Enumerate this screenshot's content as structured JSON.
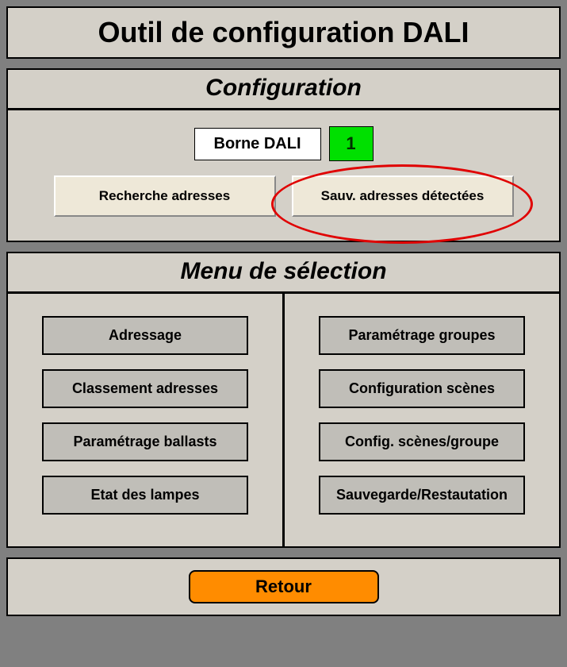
{
  "title": "Outil de configuration DALI",
  "config": {
    "heading": "Configuration",
    "borne_label": "Borne DALI",
    "borne_value": "1",
    "search_button": "Recherche adresses",
    "save_button": "Sauv. adresses détectées"
  },
  "selection": {
    "heading": "Menu de sélection",
    "left": [
      "Adressage",
      "Classement adresses",
      "Paramétrage ballasts",
      "Etat des lampes"
    ],
    "right": [
      "Paramétrage groupes",
      "Configuration scènes",
      "Config. scènes/groupe",
      "Sauvegarde/Restautation"
    ]
  },
  "footer": {
    "back_button": "Retour"
  },
  "colors": {
    "accent_green": "#00e000",
    "accent_orange": "#ff8c00",
    "highlight_red": "#e00000"
  }
}
